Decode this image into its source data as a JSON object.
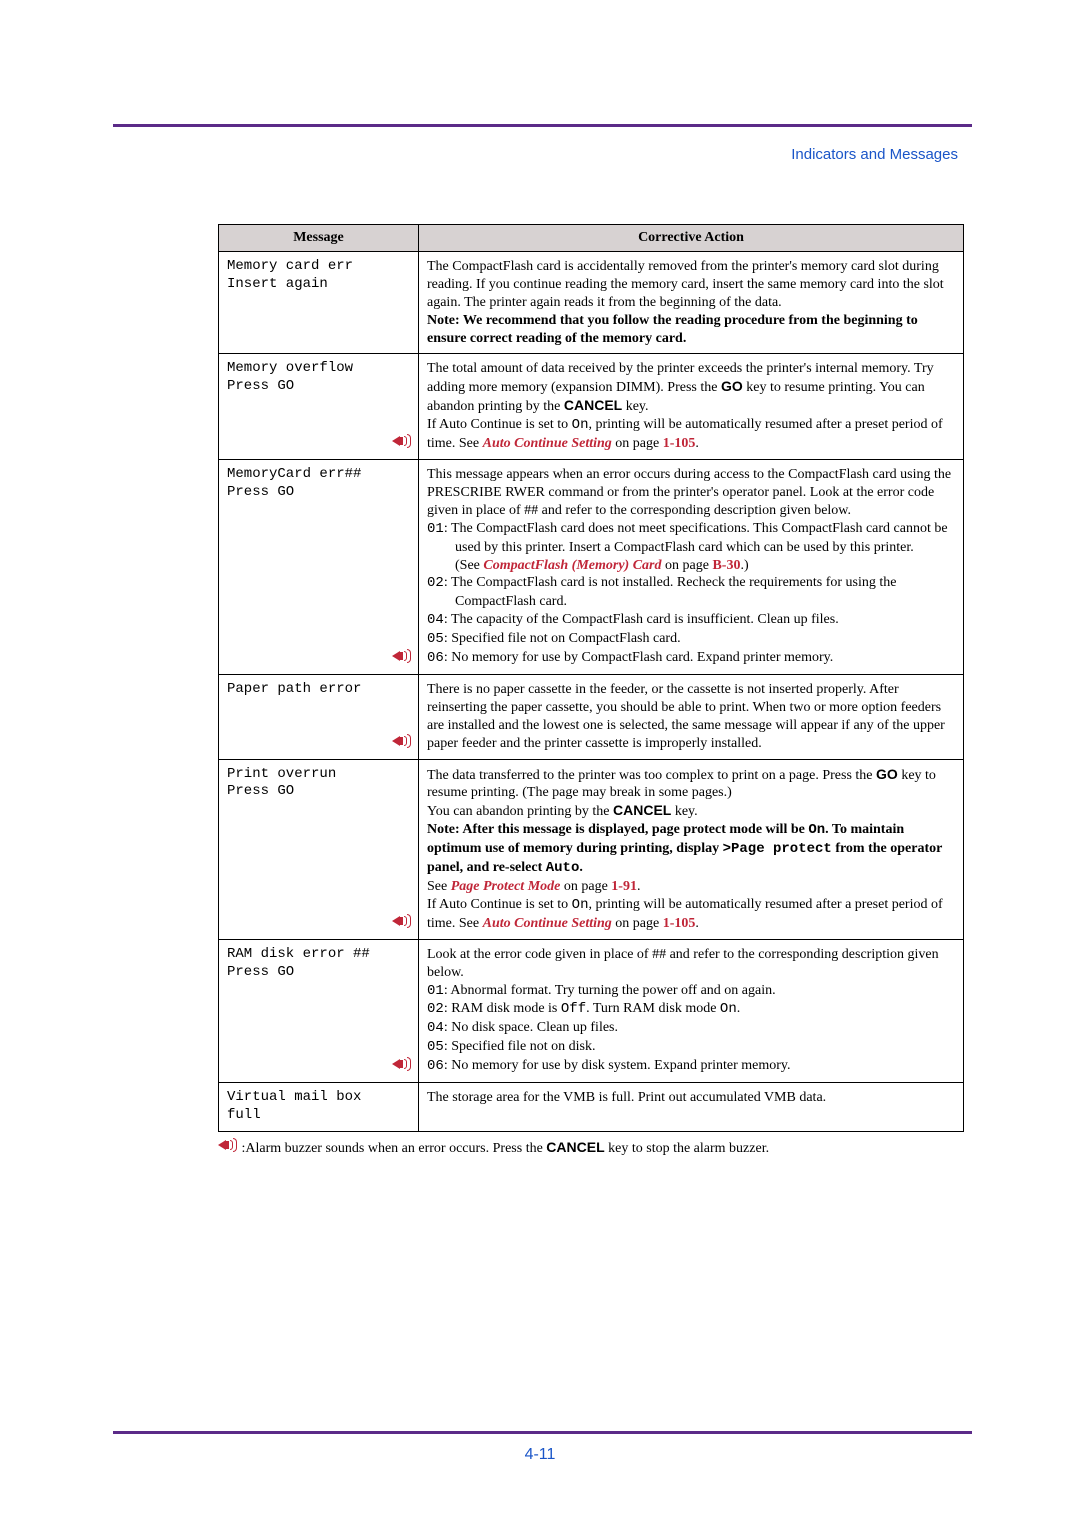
{
  "header": {
    "section_link": "Indicators and Messages"
  },
  "page_number": "4-11",
  "table": {
    "headers": {
      "message": "Message",
      "action": "Corrective Action"
    },
    "rows": [
      {
        "msg_line1": "Memory card err",
        "msg_line2": " Insert again",
        "has_sound": false,
        "action_html": "The CompactFlash card is accidentally removed from the printer's memory card slot during reading. If you continue reading the memory card, insert the same memory card into the slot again. The printer again reads it from the beginning of the data.<br><b>Note: We recommend that you follow the reading procedure from the beginning to ensure correct reading of the memory card.</b>"
      },
      {
        "msg_line1": "Memory overflow",
        "msg_line2": "Press GO",
        "has_sound": true,
        "action_html": "The total amount of data received by the printer exceeds the printer's internal memory. Try adding more memory (expansion DIMM). Press the <span class='sans-bold'>GO</span> key to resume printing. You can abandon printing by the <span class='sans-bold'>CANCEL</span> key.<br>If Auto Continue is set to <span class='mono'>On</span>, printing will be automatically resumed after a preset period of time. See <span class='link'>Auto Continue Setting</span> on page <span class='link-only'>1-105</span>."
      },
      {
        "msg_line1": "MemoryCard err##",
        "msg_line2": "Press GO",
        "has_sound": true,
        "action_html": "This message appears when an error occurs during access to the CompactFlash card using the PRESCRIBE RWER command or from the printer's operator panel. Look at the error code given in place of ## and refer to the corresponding description given below.<br><span class='indent'><span class='mono'>01</span>: The CompactFlash card does not meet specifications.  This CompactFlash card cannot be used by this printer.  Insert a CompactFlash card which can be used by this printer.</span><span class='indent2'>(See <span class='link'>CompactFlash (Memory) Card</span> on page <span class='link-only'>B-30</span>.)</span><span class='indent'><span class='mono'>02</span>: The CompactFlash card is not installed. Recheck the requirements for using the CompactFlash card.</span><span class='indent'><span class='mono'>04</span>: The capacity of the CompactFlash card is insufficient. Clean up files.</span><span class='indent'><span class='mono'>05</span>: Specified file not on CompactFlash card.</span><span class='indent'><span class='mono'>06</span>: No memory for use by CompactFlash card. Expand printer memory.</span>"
      },
      {
        "msg_line1": "Paper path error",
        "msg_line2": "",
        "has_sound": true,
        "action_html": "There is no paper cassette in the feeder, or the cassette is not inserted properly. After reinserting the paper cassette, you should be able to print. When two or more option feeders are installed and the lowest one is selected, the same message will appear if any of the upper paper feeder and the printer cassette is improperly installed."
      },
      {
        "msg_line1": "Print overrun",
        "msg_line2": "Press GO",
        "has_sound": true,
        "action_html": "The data transferred to the printer was too complex to print on a page. Press the <span class='sans-bold'>GO</span> key to resume printing. (The page may break in some pages.)<br>You can abandon printing by the <span class='sans-bold'>CANCEL</span> key.<br><b>Note: After this message is displayed, page protect mode will be <span class='mono'>On</span>. To maintain optimum use of memory during printing, display <span class='mono'>&gt;Page protect</span> from the operator panel, and re-select <span class='mono'>Auto</span>.</b><br>See <span class='link'>Page Protect Mode</span> on page <span class='link-only'>1-91</span>.<br>If Auto Continue is set to <span class='mono'>On</span>, printing will be automatically resumed after a preset period of time. See <span class='link'>Auto Continue Setting</span> on page <span class='link-only'>1-105</span>."
      },
      {
        "msg_line1": "RAM disk error ##",
        "msg_line2": "Press GO",
        "has_sound": true,
        "action_html": "Look at the error code given in place of ## and refer to the corresponding description given below.<br><span class='indent'><span class='mono'>01</span>: Abnormal format. Try turning the power off and on again.</span><span class='indent'><span class='mono'>02</span>: RAM disk mode is <span class='mono'>Off</span>. Turn RAM disk mode <span class='mono'>On</span>.</span><span class='indent'><span class='mono'>04</span>: No disk space. Clean up files.</span><span class='indent'><span class='mono'>05</span>: Specified file not on disk.</span><span class='indent'><span class='mono'>06</span>: No memory for use by disk system. Expand printer memory.</span>"
      },
      {
        "msg_line1": "Virtual mail box",
        "msg_line2": "full",
        "has_sound": false,
        "action_html": "The storage area for the VMB is full. Print out accumulated VMB data."
      }
    ]
  },
  "footnote": {
    "before": " :Alarm buzzer sounds when an error occurs. Press the ",
    "cancel": "CANCEL",
    "after": " key to stop the alarm buzzer."
  }
}
